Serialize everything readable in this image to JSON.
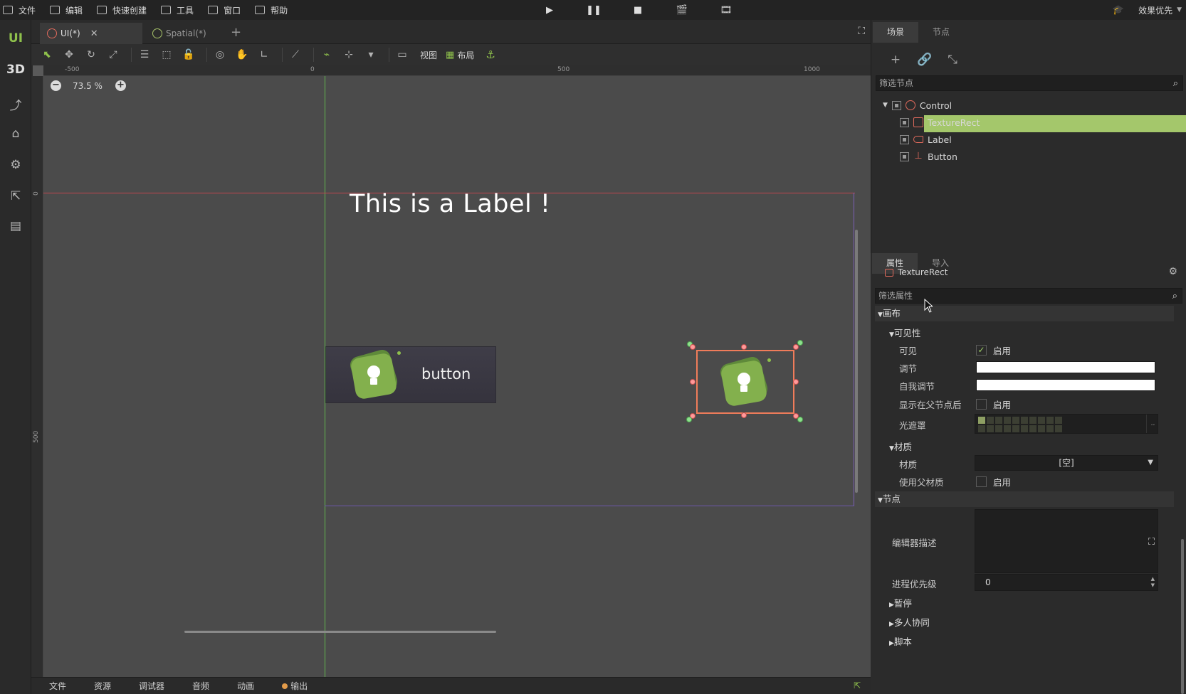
{
  "menu": {
    "items": [
      "文件",
      "编辑",
      "快速创建",
      "工具",
      "窗口",
      "帮助"
    ],
    "render_mode": "效果优先"
  },
  "left_toolbar": {
    "ui_label": "UI",
    "three_d_label": "3D"
  },
  "viewport": {
    "tabs": [
      {
        "label": "UI(*)",
        "active": true
      },
      {
        "label": "Spatial(*)",
        "active": false
      }
    ],
    "toolbar": {
      "view_label": "视图",
      "layout_label": "布局"
    },
    "ruler_top_labels": [
      "-500",
      "0",
      "500",
      "1000"
    ],
    "ruler_left_labels": [
      "0",
      "500"
    ],
    "zoom": "73.5 %",
    "canvas_label_text": "This is a Label !",
    "canvas_button_text": "button"
  },
  "bottom_tabs": [
    "文件",
    "资源",
    "调试器",
    "音频",
    "动画",
    "输出"
  ],
  "scene_panel": {
    "tabs": [
      "场景",
      "节点"
    ],
    "filter_placeholder": "筛选节点",
    "tree": [
      {
        "name": "Control",
        "depth": 0
      },
      {
        "name": "TextureRect",
        "depth": 1,
        "selected": true
      },
      {
        "name": "Label",
        "depth": 1
      },
      {
        "name": "Button",
        "depth": 1
      }
    ]
  },
  "inspector": {
    "tabs": [
      "属性",
      "导入"
    ],
    "object_name": "TextureRect",
    "filter_placeholder": "筛选属性",
    "sections": {
      "canvas": "画布",
      "visibility": "可见性",
      "material_group": "材质",
      "node": "节点",
      "pause": "暂停",
      "multiplayer": "多人协同",
      "script": "脚本"
    },
    "props": {
      "visible": "可见",
      "visible_value": "启用",
      "modulate": "调节",
      "self_modulate": "自我调节",
      "show_behind_parent": "显示在父节点后",
      "show_behind_parent_value": "启用",
      "light_mask": "光遮罩",
      "material": "材质",
      "material_value": "[空]",
      "use_parent_material": "使用父材质",
      "use_parent_material_value": "启用",
      "editor_description": "编辑器描述",
      "process_priority": "进程优先级",
      "process_priority_value": "0"
    }
  }
}
